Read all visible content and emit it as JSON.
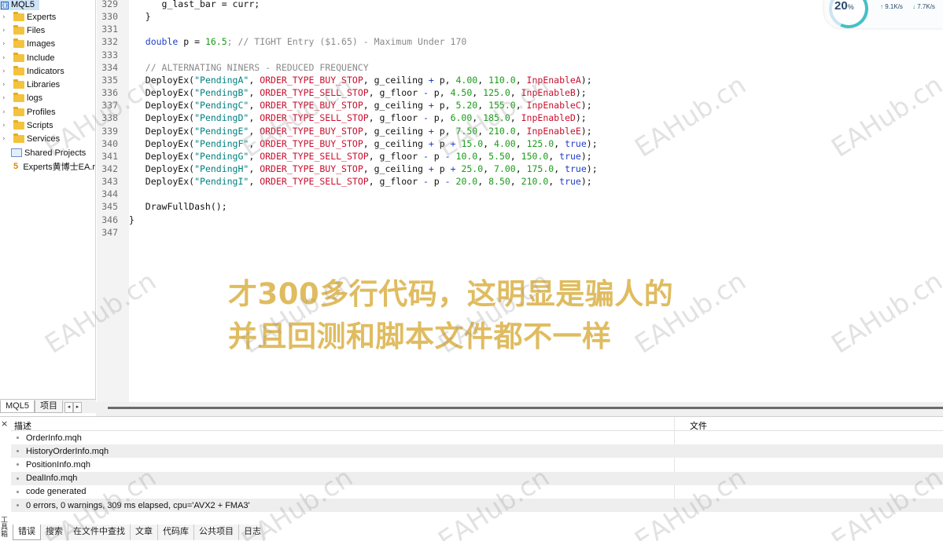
{
  "navigator": {
    "root": "MQL5",
    "items": [
      {
        "label": "Experts",
        "type": "folder"
      },
      {
        "label": "Files",
        "type": "folder"
      },
      {
        "label": "Images",
        "type": "folder"
      },
      {
        "label": "Include",
        "type": "folder"
      },
      {
        "label": "Indicators",
        "type": "folder"
      },
      {
        "label": "Libraries",
        "type": "folder"
      },
      {
        "label": "logs",
        "type": "folder"
      },
      {
        "label": "Profiles",
        "type": "folder"
      },
      {
        "label": "Scripts",
        "type": "folder"
      },
      {
        "label": "Services",
        "type": "folder"
      },
      {
        "label": "Shared Projects",
        "type": "shared"
      },
      {
        "label": "Experts黄博士EA.r",
        "type": "mq5",
        "badge": "5"
      }
    ],
    "tabs": [
      "MQL5",
      "项目"
    ],
    "tab_arrows": [
      "◂",
      "▸"
    ]
  },
  "editor": {
    "lines": [
      {
        "n": "329",
        "tokens": [
          {
            "t": "      g_last_bar = curr;",
            "c": "var"
          }
        ]
      },
      {
        "n": "330",
        "tokens": [
          {
            "t": "   }",
            "c": "var"
          }
        ]
      },
      {
        "n": "331",
        "tokens": []
      },
      {
        "n": "332",
        "tokens": [
          {
            "t": "   ",
            "c": "var"
          },
          {
            "t": "double",
            "c": "kw"
          },
          {
            "t": " p = ",
            "c": "var"
          },
          {
            "t": "16.5",
            "c": "num"
          },
          {
            "t": "; // TIGHT Entry ($1.65) - Maximum Under 170",
            "c": "cmt"
          }
        ]
      },
      {
        "n": "333",
        "tokens": []
      },
      {
        "n": "334",
        "tokens": [
          {
            "t": "   // ALTERNATING NINERS - REDUCED FREQUENCY",
            "c": "cmt"
          }
        ]
      },
      {
        "n": "335",
        "tokens": [
          {
            "t": "   DeployEx(",
            "c": "fn"
          },
          {
            "t": "\"PendingA\"",
            "c": "str"
          },
          {
            "t": ", ",
            "c": "var"
          },
          {
            "t": "ORDER_TYPE_BUY_STOP",
            "c": "const"
          },
          {
            "t": ", g_ceiling ",
            "c": "var"
          },
          {
            "t": "+",
            "c": "op"
          },
          {
            "t": " p, ",
            "c": "var"
          },
          {
            "t": "4.00",
            "c": "num"
          },
          {
            "t": ", ",
            "c": "var"
          },
          {
            "t": "110.0",
            "c": "num"
          },
          {
            "t": ", ",
            "c": "var"
          },
          {
            "t": "InpEnableA",
            "c": "const"
          },
          {
            "t": ");",
            "c": "var"
          }
        ]
      },
      {
        "n": "336",
        "tokens": [
          {
            "t": "   DeployEx(",
            "c": "fn"
          },
          {
            "t": "\"PendingB\"",
            "c": "str"
          },
          {
            "t": ", ",
            "c": "var"
          },
          {
            "t": "ORDER_TYPE_SELL_STOP",
            "c": "const"
          },
          {
            "t": ", g_floor ",
            "c": "var"
          },
          {
            "t": "-",
            "c": "op"
          },
          {
            "t": " p, ",
            "c": "var"
          },
          {
            "t": "4.50",
            "c": "num"
          },
          {
            "t": ", ",
            "c": "var"
          },
          {
            "t": "125.0",
            "c": "num"
          },
          {
            "t": ", ",
            "c": "var"
          },
          {
            "t": "InpEnableB",
            "c": "const"
          },
          {
            "t": ");",
            "c": "var"
          }
        ]
      },
      {
        "n": "337",
        "tokens": [
          {
            "t": "   DeployEx(",
            "c": "fn"
          },
          {
            "t": "\"PendingC\"",
            "c": "str"
          },
          {
            "t": ", ",
            "c": "var"
          },
          {
            "t": "ORDER_TYPE_BUY_STOP",
            "c": "const"
          },
          {
            "t": ", g_ceiling ",
            "c": "var"
          },
          {
            "t": "+",
            "c": "op"
          },
          {
            "t": " p, ",
            "c": "var"
          },
          {
            "t": "5.20",
            "c": "num"
          },
          {
            "t": ", ",
            "c": "var"
          },
          {
            "t": "155.0",
            "c": "num"
          },
          {
            "t": ", ",
            "c": "var"
          },
          {
            "t": "InpEnableC",
            "c": "const"
          },
          {
            "t": ");",
            "c": "var"
          }
        ]
      },
      {
        "n": "338",
        "tokens": [
          {
            "t": "   DeployEx(",
            "c": "fn"
          },
          {
            "t": "\"PendingD\"",
            "c": "str"
          },
          {
            "t": ", ",
            "c": "var"
          },
          {
            "t": "ORDER_TYPE_SELL_STOP",
            "c": "const"
          },
          {
            "t": ", g_floor ",
            "c": "var"
          },
          {
            "t": "-",
            "c": "op"
          },
          {
            "t": " p, ",
            "c": "var"
          },
          {
            "t": "6.00",
            "c": "num"
          },
          {
            "t": ", ",
            "c": "var"
          },
          {
            "t": "185.0",
            "c": "num"
          },
          {
            "t": ", ",
            "c": "var"
          },
          {
            "t": "InpEnableD",
            "c": "const"
          },
          {
            "t": ");",
            "c": "var"
          }
        ]
      },
      {
        "n": "339",
        "tokens": [
          {
            "t": "   DeployEx(",
            "c": "fn"
          },
          {
            "t": "\"PendingE\"",
            "c": "str"
          },
          {
            "t": ", ",
            "c": "var"
          },
          {
            "t": "ORDER_TYPE_BUY_STOP",
            "c": "const"
          },
          {
            "t": ", g_ceiling ",
            "c": "var"
          },
          {
            "t": "+",
            "c": "op"
          },
          {
            "t": " p, ",
            "c": "var"
          },
          {
            "t": "7.50",
            "c": "num"
          },
          {
            "t": ", ",
            "c": "var"
          },
          {
            "t": "210.0",
            "c": "num"
          },
          {
            "t": ", ",
            "c": "var"
          },
          {
            "t": "InpEnableE",
            "c": "const"
          },
          {
            "t": ");",
            "c": "var"
          }
        ]
      },
      {
        "n": "340",
        "tokens": [
          {
            "t": "   DeployEx(",
            "c": "fn"
          },
          {
            "t": "\"PendingF\"",
            "c": "str"
          },
          {
            "t": ", ",
            "c": "var"
          },
          {
            "t": "ORDER_TYPE_BUY_STOP",
            "c": "const"
          },
          {
            "t": ", g_ceiling ",
            "c": "var"
          },
          {
            "t": "+",
            "c": "op"
          },
          {
            "t": " p ",
            "c": "var"
          },
          {
            "t": "+",
            "c": "op"
          },
          {
            "t": " ",
            "c": "var"
          },
          {
            "t": "15.0",
            "c": "num"
          },
          {
            "t": ", ",
            "c": "var"
          },
          {
            "t": "4.00",
            "c": "num"
          },
          {
            "t": ", ",
            "c": "var"
          },
          {
            "t": "125.0",
            "c": "num"
          },
          {
            "t": ", ",
            "c": "var"
          },
          {
            "t": "true",
            "c": "bool"
          },
          {
            "t": ");",
            "c": "var"
          }
        ]
      },
      {
        "n": "341",
        "tokens": [
          {
            "t": "   DeployEx(",
            "c": "fn"
          },
          {
            "t": "\"PendingG\"",
            "c": "str"
          },
          {
            "t": ", ",
            "c": "var"
          },
          {
            "t": "ORDER_TYPE_SELL_STOP",
            "c": "const"
          },
          {
            "t": ", g_floor ",
            "c": "var"
          },
          {
            "t": "-",
            "c": "op"
          },
          {
            "t": " p ",
            "c": "var"
          },
          {
            "t": "-",
            "c": "op"
          },
          {
            "t": " ",
            "c": "var"
          },
          {
            "t": "10.0",
            "c": "num"
          },
          {
            "t": ", ",
            "c": "var"
          },
          {
            "t": "5.50",
            "c": "num"
          },
          {
            "t": ", ",
            "c": "var"
          },
          {
            "t": "150.0",
            "c": "num"
          },
          {
            "t": ", ",
            "c": "var"
          },
          {
            "t": "true",
            "c": "bool"
          },
          {
            "t": ");",
            "c": "var"
          }
        ]
      },
      {
        "n": "342",
        "tokens": [
          {
            "t": "   DeployEx(",
            "c": "fn"
          },
          {
            "t": "\"PendingH\"",
            "c": "str"
          },
          {
            "t": ", ",
            "c": "var"
          },
          {
            "t": "ORDER_TYPE_BUY_STOP",
            "c": "const"
          },
          {
            "t": ", g_ceiling ",
            "c": "var"
          },
          {
            "t": "+",
            "c": "op"
          },
          {
            "t": " p ",
            "c": "var"
          },
          {
            "t": "+",
            "c": "op"
          },
          {
            "t": " ",
            "c": "var"
          },
          {
            "t": "25.0",
            "c": "num"
          },
          {
            "t": ", ",
            "c": "var"
          },
          {
            "t": "7.00",
            "c": "num"
          },
          {
            "t": ", ",
            "c": "var"
          },
          {
            "t": "175.0",
            "c": "num"
          },
          {
            "t": ", ",
            "c": "var"
          },
          {
            "t": "true",
            "c": "bool"
          },
          {
            "t": ");",
            "c": "var"
          }
        ]
      },
      {
        "n": "343",
        "tokens": [
          {
            "t": "   DeployEx(",
            "c": "fn"
          },
          {
            "t": "\"PendingI\"",
            "c": "str"
          },
          {
            "t": ", ",
            "c": "var"
          },
          {
            "t": "ORDER_TYPE_SELL_STOP",
            "c": "const"
          },
          {
            "t": ", g_floor ",
            "c": "var"
          },
          {
            "t": "-",
            "c": "op"
          },
          {
            "t": " p ",
            "c": "var"
          },
          {
            "t": "-",
            "c": "op"
          },
          {
            "t": " ",
            "c": "var"
          },
          {
            "t": "20.0",
            "c": "num"
          },
          {
            "t": ", ",
            "c": "var"
          },
          {
            "t": "8.50",
            "c": "num"
          },
          {
            "t": ", ",
            "c": "var"
          },
          {
            "t": "210.0",
            "c": "num"
          },
          {
            "t": ", ",
            "c": "var"
          },
          {
            "t": "true",
            "c": "bool"
          },
          {
            "t": ");",
            "c": "var"
          }
        ]
      },
      {
        "n": "344",
        "tokens": []
      },
      {
        "n": "345",
        "tokens": [
          {
            "t": "   DrawFullDash();",
            "c": "fn"
          }
        ]
      },
      {
        "n": "346",
        "tokens": [
          {
            "t": "}",
            "c": "var"
          }
        ]
      },
      {
        "n": "347",
        "tokens": []
      }
    ]
  },
  "toolbox": {
    "close_glyph": "×",
    "side_label": "工具箱",
    "col_desc": "描述",
    "col_file": "文件",
    "rows": [
      "OrderInfo.mqh",
      "HistoryOrderInfo.mqh",
      "PositionInfo.mqh",
      "DealInfo.mqh",
      "code generated",
      "0 errors, 0 warnings, 309 ms elapsed, cpu='AVX2 + FMA3'"
    ],
    "tabs": [
      "错误",
      "搜索",
      "在文件中查找",
      "文章",
      "代码库",
      "公共项目",
      "日志"
    ]
  },
  "net_widget": {
    "percent": "20",
    "percent_unit": "%",
    "up": "9.1K/s",
    "down": "7.7K/s",
    "up_arrow": "↑",
    "down_arrow": "↓"
  },
  "overlay": {
    "line1": "才300多行代码，这明显是骗人的",
    "line2": "并且回测和脚本文件都不一样",
    "color": "#ddb653"
  },
  "watermark": "EAHub.cn"
}
